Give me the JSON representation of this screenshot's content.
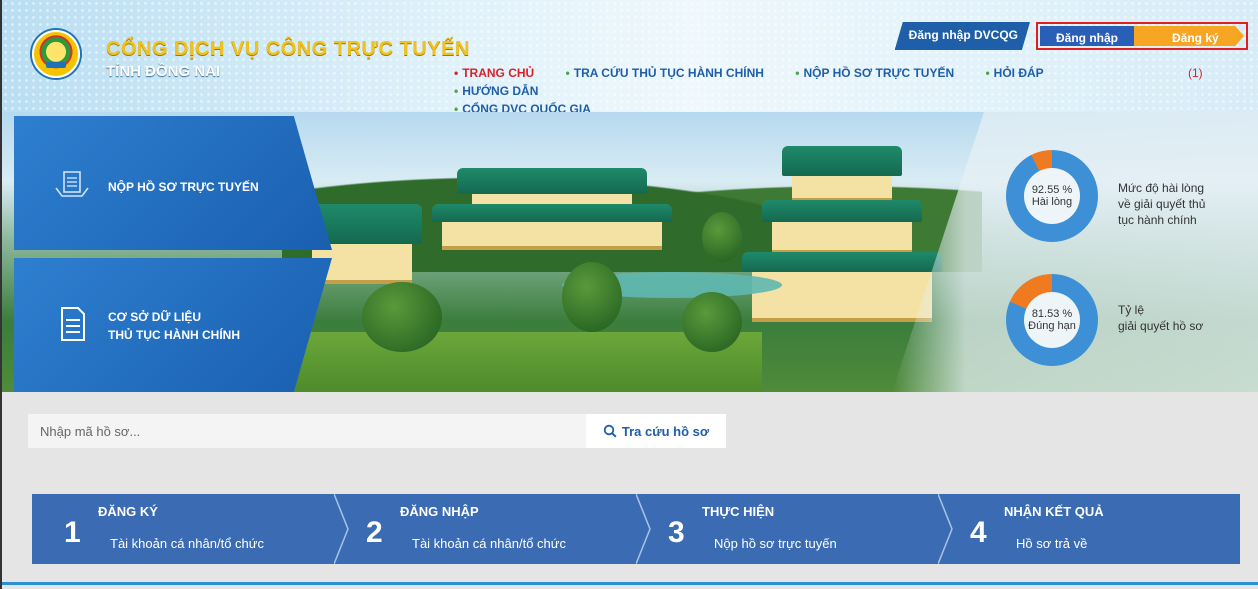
{
  "header": {
    "title": "CỔNG DỊCH VỤ CÔNG TRỰC TUYẾN",
    "subtitle": "TỈNH ĐỒNG NAI",
    "btn_dvcqg": "Đăng nhập DVCQG",
    "btn_login": "Đăng nhập",
    "btn_register": "Đăng ký",
    "annotation": "(1)"
  },
  "nav": {
    "items": [
      "TRANG CHỦ",
      "TRA CỨU THỦ TỤC HÀNH CHÍNH",
      "NỘP HỒ SƠ TRỰC TUYẾN",
      "HỎI ĐÁP",
      "HƯỚNG DẪN",
      "CỔNG DVC QUỐC GIA"
    ]
  },
  "cards": {
    "card1": "NỘP HỒ SƠ TRỰC TUYẾN",
    "card2_line1": "CƠ SỞ DỮ LIỆU",
    "card2_line2": "THỦ TỤC HÀNH CHÍNH"
  },
  "stats": {
    "s1_value": "92.55 %",
    "s1_fraction": 0.9255,
    "s1_sub": "Hài lòng",
    "s1_label_1": "Mức độ hài lòng",
    "s1_label_2": "về giải quyết thủ",
    "s1_label_3": "tục hành chính",
    "s2_value": "81.53 %",
    "s2_fraction": 0.8153,
    "s2_sub": "Đúng hạn",
    "s2_label_1": "Tỷ lệ",
    "s2_label_2": "giải quyết hồ sơ",
    "color_primary": "#3d8fd6",
    "color_rest": "#f07a1f"
  },
  "search": {
    "placeholder": "Nhập mã hồ sơ...",
    "button": "Tra cứu hồ sơ"
  },
  "steps": [
    {
      "num": "1",
      "title": "ĐĂNG KÝ",
      "desc": "Tài khoản cá nhân/tổ chức"
    },
    {
      "num": "2",
      "title": "ĐĂNG NHẬP",
      "desc": "Tài khoản cá nhân/tổ chức"
    },
    {
      "num": "3",
      "title": "THỰC HIỆN",
      "desc": "Nộp hồ sơ trực tuyến"
    },
    {
      "num": "4",
      "title": "NHẬN KẾT QUẢ",
      "desc": "Hồ sơ trả về"
    }
  ]
}
